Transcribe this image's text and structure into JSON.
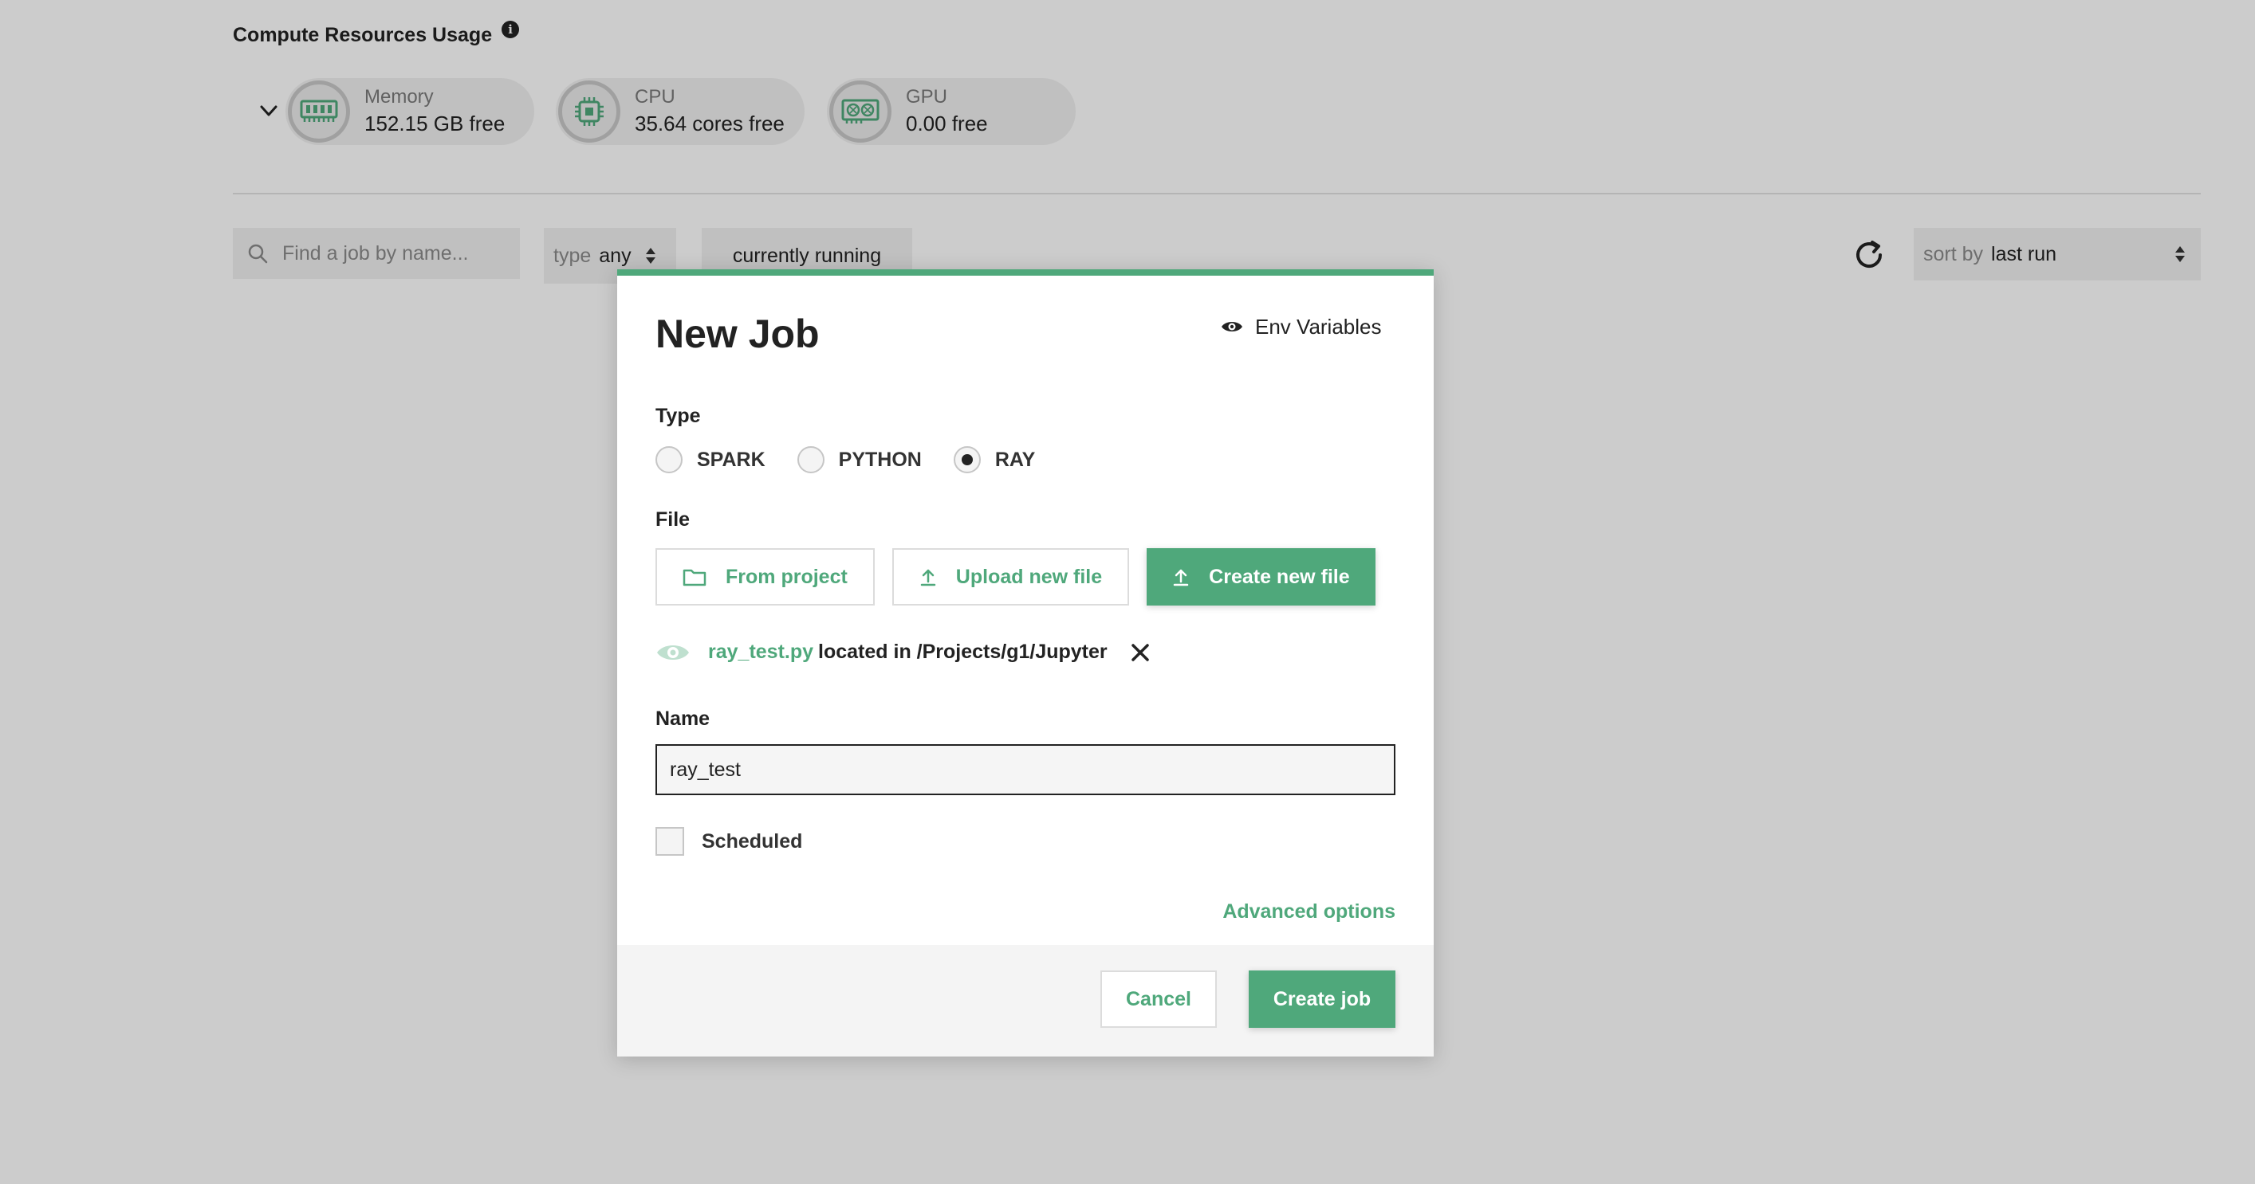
{
  "resources": {
    "title": "Compute Resources Usage",
    "items": [
      {
        "label": "Memory",
        "value": "152.15 GB free",
        "icon": "memory-icon"
      },
      {
        "label": "CPU",
        "value": "35.64 cores free",
        "icon": "cpu-icon"
      },
      {
        "label": "GPU",
        "value": "0.00 free",
        "icon": "gpu-icon"
      }
    ]
  },
  "filters": {
    "search_placeholder": "Find a job by name...",
    "type_label": "type",
    "type_value": "any",
    "running_tab": "currently running",
    "sort_label": "sort by",
    "sort_value": "last run"
  },
  "modal": {
    "title": "New Job",
    "env_label": "Env Variables",
    "type_section": "Type",
    "types": [
      {
        "label": "SPARK",
        "selected": false
      },
      {
        "label": "PYTHON",
        "selected": false
      },
      {
        "label": "RAY",
        "selected": true
      }
    ],
    "file_section": "File",
    "file_buttons": {
      "from_project": "From project",
      "upload": "Upload new file",
      "create": "Create new file"
    },
    "selected_file": {
      "name": "ray_test.py",
      "location": "located in /Projects/g1/Jupyter"
    },
    "name_section": "Name",
    "name_value": "ray_test",
    "scheduled_label": "Scheduled",
    "advanced_label": "Advanced options",
    "cancel_label": "Cancel",
    "create_label": "Create job"
  },
  "colors": {
    "accent": "#4fa87b",
    "overlay": "rgba(0,0,0,0.2)"
  }
}
